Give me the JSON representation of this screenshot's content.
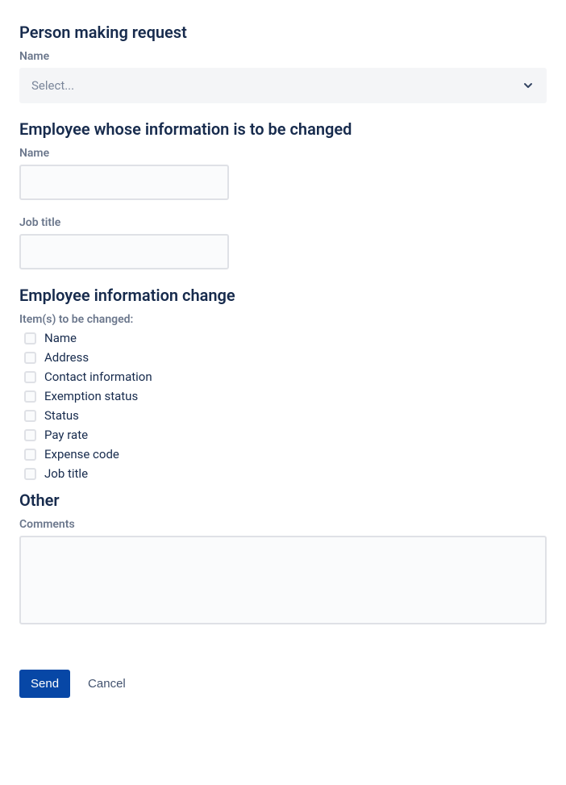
{
  "requester": {
    "heading": "Person making request",
    "name_label": "Name",
    "select_placeholder": "Select..."
  },
  "employee": {
    "heading": "Employee whose information is to be changed",
    "name_label": "Name",
    "name_value": "",
    "job_title_label": "Job title",
    "job_title_value": ""
  },
  "change": {
    "heading": "Employee information change",
    "items_label": "Item(s) to be changed:",
    "items": [
      {
        "label": "Name"
      },
      {
        "label": "Address"
      },
      {
        "label": "Contact information"
      },
      {
        "label": "Exemption status"
      },
      {
        "label": "Status"
      },
      {
        "label": "Pay rate"
      },
      {
        "label": "Expense code"
      },
      {
        "label": "Job title"
      }
    ]
  },
  "other": {
    "heading": "Other",
    "comments_label": "Comments",
    "comments_value": ""
  },
  "actions": {
    "send": "Send",
    "cancel": "Cancel"
  }
}
